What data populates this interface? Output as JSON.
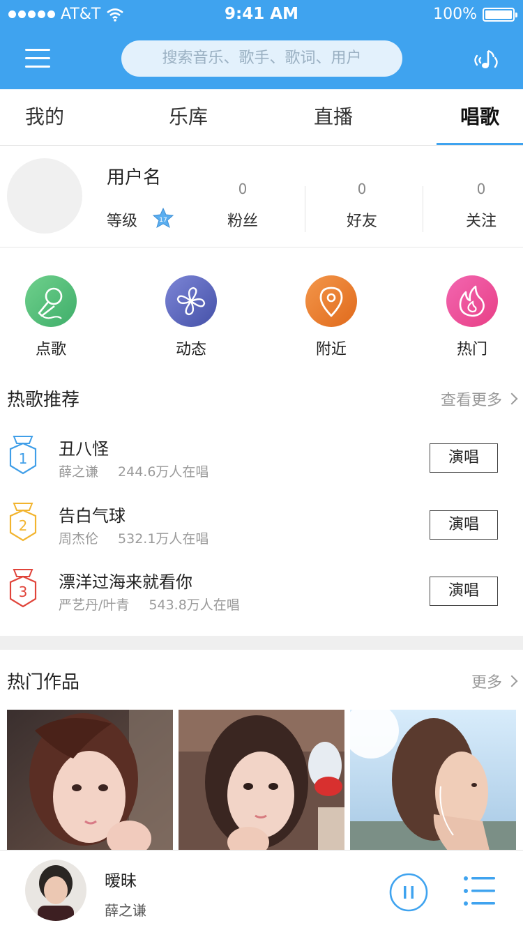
{
  "status_bar": {
    "carrier": "AT&T",
    "time": "9:41 AM",
    "battery": "100%"
  },
  "header": {
    "search_placeholder": "搜索音乐、歌手、歌词、用户"
  },
  "tabs": [
    {
      "label": "我的"
    },
    {
      "label": "乐库"
    },
    {
      "label": "直播"
    },
    {
      "label": "唱歌",
      "active": true
    }
  ],
  "profile": {
    "username": "用户名",
    "level_label": "等级",
    "level": "17",
    "stats": [
      {
        "value": "0",
        "label": "粉丝"
      },
      {
        "value": "0",
        "label": "好友"
      },
      {
        "value": "0",
        "label": "关注"
      }
    ]
  },
  "categories": [
    {
      "label": "点歌",
      "icon": "microphone-icon",
      "color": "#5cbf7d"
    },
    {
      "label": "动态",
      "icon": "pinwheel-icon",
      "color": "#5761b5"
    },
    {
      "label": "附近",
      "icon": "location-pin-icon",
      "color": "#ee7a2a"
    },
    {
      "label": "热门",
      "icon": "flame-icon",
      "color": "#e8509a"
    }
  ],
  "hot_songs": {
    "title": "热歌推荐",
    "more": "查看更多",
    "songs": [
      {
        "rank": "1",
        "title": "丑八怪",
        "artist": "薛之谦",
        "count": "244.6万人在唱",
        "action": "演唱",
        "rank_color": "#3f9ee8"
      },
      {
        "rank": "2",
        "title": "告白气球",
        "artist": "周杰伦",
        "count": "532.1万人在唱",
        "action": "演唱",
        "rank_color": "#f2b42e"
      },
      {
        "rank": "3",
        "title": "漂洋过海来就看你",
        "artist": "严艺丹/叶青",
        "count": "543.8万人在唱",
        "action": "演唱",
        "rank_color": "#e0443a"
      }
    ]
  },
  "hot_works": {
    "title": "热门作品",
    "more": "更多"
  },
  "player": {
    "title": "暧昧",
    "artist": "薛之谦"
  },
  "colors": {
    "accent": "#3fa3ef",
    "search_bg": "#e3f1fc"
  }
}
